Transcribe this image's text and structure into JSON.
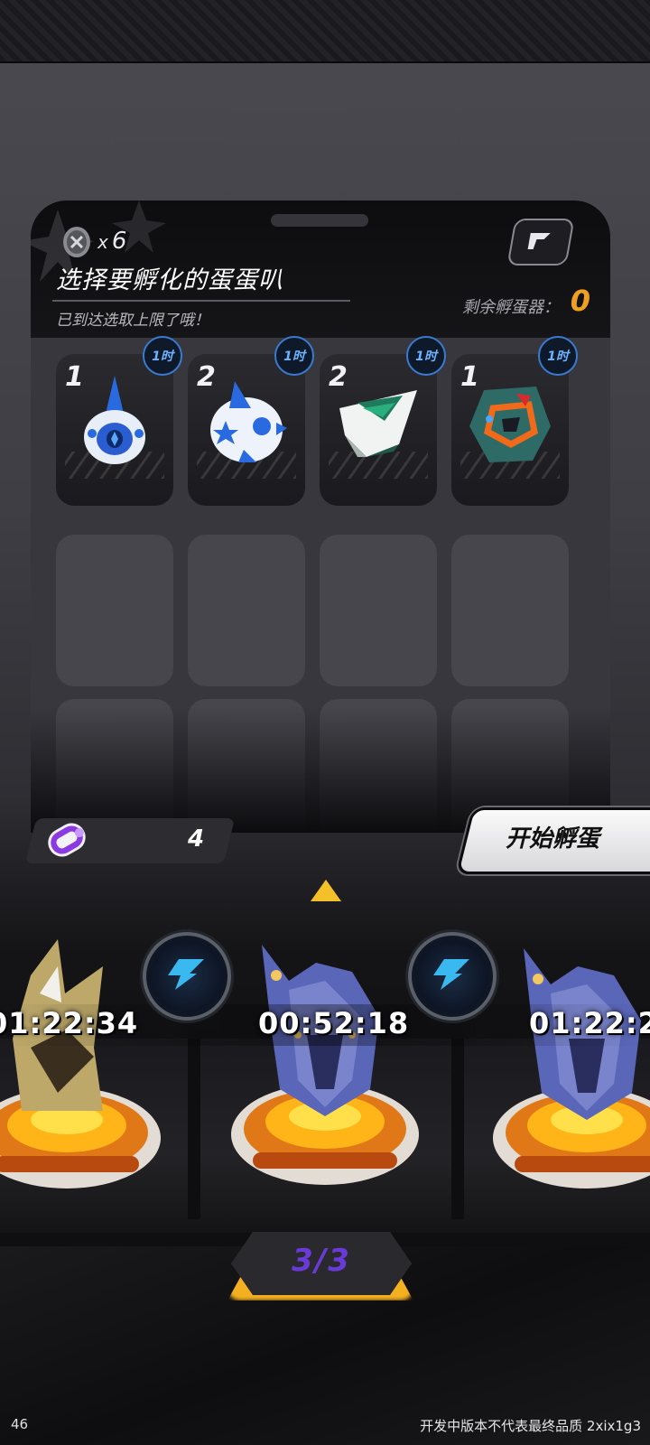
{
  "panel": {
    "egg_count_prefix": "x",
    "egg_count": "6",
    "title": "选择要孵化的蛋蛋叭",
    "subtitle": "已到达选取上限了哦！",
    "remaining_label": "剩余孵蛋器：",
    "remaining_value": "0"
  },
  "eggs": [
    {
      "count": "1",
      "time": "1时",
      "name": "blue-drop-egg-icon"
    },
    {
      "count": "2",
      "time": "1时",
      "name": "blue-star-egg-icon"
    },
    {
      "count": "2",
      "time": "1时",
      "name": "green-white-egg-icon"
    },
    {
      "count": "1",
      "time": "1时",
      "name": "teal-orange-egg-icon"
    }
  ],
  "resource": {
    "value": "4"
  },
  "start_button": {
    "label": "开始孵蛋"
  },
  "incubators": [
    {
      "timer": "01:22:34"
    },
    {
      "timer": "00:52:18"
    },
    {
      "timer": "01:22:2"
    }
  ],
  "pager": {
    "label": "3/3"
  },
  "footer": {
    "left": "46",
    "right": "开发中版本不代表最终品质 2xix1g3"
  },
  "colors": {
    "accent_orange": "#f0a020",
    "timer_blue": "#3a7ad0",
    "pager_purple": "#6a3ad8"
  }
}
